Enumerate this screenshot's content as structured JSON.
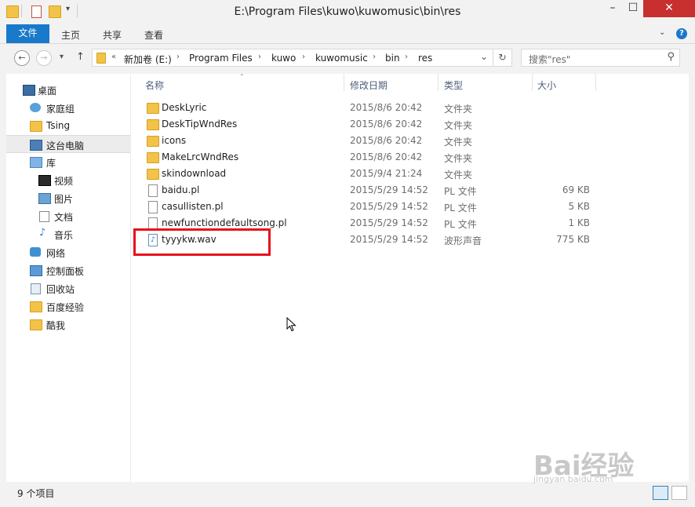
{
  "window": {
    "title": "E:\\Program Files\\kuwo\\kuwomusic\\bin\\res",
    "minimize": "–",
    "maximize": "☐",
    "close": "✕"
  },
  "ribbon": {
    "tabs": [
      "文件",
      "主页",
      "共享",
      "查看"
    ],
    "help": "?"
  },
  "navbar": {
    "back": "←",
    "forward": "→",
    "recent": "▾",
    "up": "↑",
    "breadcrumb_prefix": "«",
    "breadcrumb": [
      "新加卷 (E:)",
      "Program Files",
      "kuwo",
      "kuwomusic",
      "bin",
      "res"
    ],
    "dropdown": "⌄",
    "refresh": "↻",
    "search_placeholder": "搜索\"res\""
  },
  "sidebar": {
    "items": [
      {
        "label": "桌面",
        "icon": "desktop-icon"
      },
      {
        "label": "家庭组",
        "icon": "homegroup-icon"
      },
      {
        "label": "Tsing",
        "icon": "user-folder-icon"
      },
      {
        "label": "这台电脑",
        "icon": "computer-icon"
      },
      {
        "label": "库",
        "icon": "library-icon"
      },
      {
        "label": "视频",
        "icon": "video-icon"
      },
      {
        "label": "图片",
        "icon": "pictures-icon"
      },
      {
        "label": "文档",
        "icon": "documents-icon"
      },
      {
        "label": "音乐",
        "icon": "music-icon"
      },
      {
        "label": "网络",
        "icon": "network-icon"
      },
      {
        "label": "控制面板",
        "icon": "control-panel-icon"
      },
      {
        "label": "回收站",
        "icon": "recycle-bin-icon"
      },
      {
        "label": "百度经验",
        "icon": "folder-icon"
      },
      {
        "label": "酷我",
        "icon": "folder-icon"
      }
    ]
  },
  "columns": {
    "name": "名称",
    "date": "修改日期",
    "type": "类型",
    "size": "大小"
  },
  "files": [
    {
      "name": "DeskLyric",
      "date": "2015/8/6 20:42",
      "type": "文件夹",
      "size": "",
      "icon": "folder-icon"
    },
    {
      "name": "DeskTipWndRes",
      "date": "2015/8/6 20:42",
      "type": "文件夹",
      "size": "",
      "icon": "folder-icon"
    },
    {
      "name": "icons",
      "date": "2015/8/6 20:42",
      "type": "文件夹",
      "size": "",
      "icon": "folder-icon"
    },
    {
      "name": "MakeLrcWndRes",
      "date": "2015/8/6 20:42",
      "type": "文件夹",
      "size": "",
      "icon": "folder-icon"
    },
    {
      "name": "skindownload",
      "date": "2015/9/4 21:24",
      "type": "文件夹",
      "size": "",
      "icon": "folder-icon"
    },
    {
      "name": "baidu.pl",
      "date": "2015/5/29 14:52",
      "type": "PL 文件",
      "size": "69 KB",
      "icon": "file-icon"
    },
    {
      "name": "casullisten.pl",
      "date": "2015/5/29 14:52",
      "type": "PL 文件",
      "size": "5 KB",
      "icon": "file-icon"
    },
    {
      "name": "newfunctiondefaultsong.pl",
      "date": "2015/5/29 14:52",
      "type": "PL 文件",
      "size": "1 KB",
      "icon": "file-icon"
    },
    {
      "name": "tyyykw.wav",
      "date": "2015/5/29 14:52",
      "type": "波形声音",
      "size": "775 KB",
      "icon": "audio-file-icon"
    }
  ],
  "status": {
    "count": "9 个项目"
  },
  "watermark": {
    "text": "Bai经验",
    "sub": "jingyan.baidu.com"
  },
  "colors": {
    "accent": "#1979ca",
    "close": "#c7302f",
    "highlight": "#e8111c",
    "folder": "#f3c349"
  }
}
